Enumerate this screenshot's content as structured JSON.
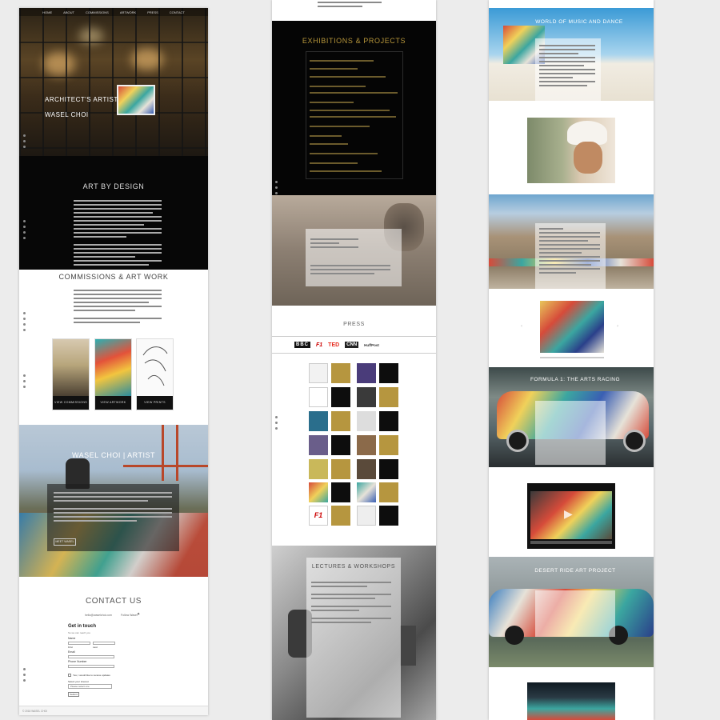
{
  "column1": {
    "nav": [
      "HOME",
      "ABOUT",
      "COMMISSIONS",
      "ARTWORK",
      "PRESS",
      "CONTACT"
    ],
    "hero": {
      "line1": "ARCHITECT'S ARTIST",
      "line2": "WASEL CHOI"
    },
    "art_by_design": {
      "title": "ART BY DESIGN"
    },
    "commissions": {
      "title": "COMMISSIONS & ART WORK",
      "cards": [
        {
          "button": "VIEW COMMISSIONS"
        },
        {
          "button": "VIEW ARTWORK"
        },
        {
          "button": "VIEW PRINTS"
        }
      ]
    },
    "artist": {
      "title": "WASEL CHOI | ARTIST",
      "button": "MEET WASEL"
    },
    "contact": {
      "title": "CONTACT US",
      "email_link": "hello@waselchoi.com",
      "social_label": "Follow Wasel",
      "social_icon": "twitter-icon",
      "form_title": "Get in touch",
      "form_subtitle": "So we can reach you",
      "fields": [
        "Name",
        "First",
        "Last",
        "Email",
        "Phone Number"
      ],
      "checkbox_label": "Yes, I would like to receive updates",
      "select_label": "Select your interest",
      "select_value": "Please select one",
      "submit": "Submit",
      "footer": "© 2018 WASEL CHOI"
    }
  },
  "column2": {
    "exhibitions_title": "EXHIBITIONS & PROJECTS",
    "press_title": "PRESS",
    "press_logos": [
      "BBC",
      "F1",
      "TED",
      "CNN",
      "HuffPost"
    ],
    "lectures_title": "LECTURES & WORKSHOPS"
  },
  "column3": {
    "titles": [
      "WORLD OF MUSIC AND DANCE",
      "FORMULA 1: THE ARTS RACING",
      "DESERT RIDE ART PROJECT"
    ]
  },
  "colors": {
    "background": "#ececec",
    "black": "#070707",
    "gold": "#b7963a",
    "white": "#ffffff"
  }
}
